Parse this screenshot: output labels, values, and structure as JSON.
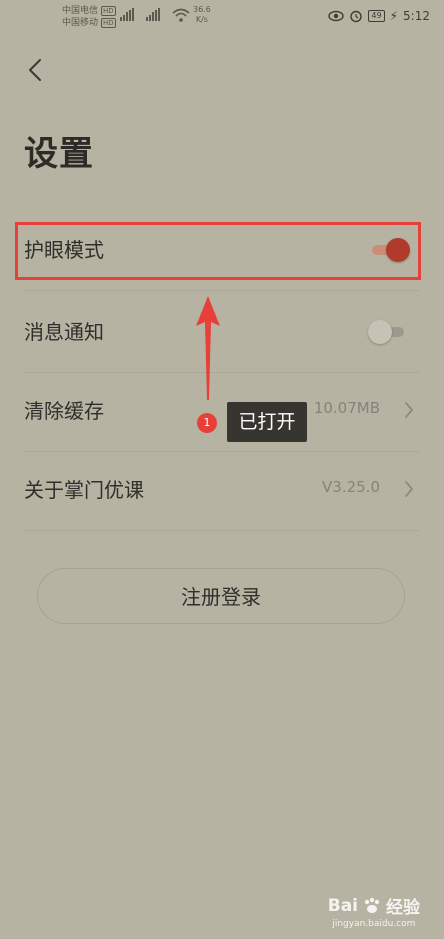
{
  "status_bar": {
    "carrier1": "中国电信",
    "carrier2": "中国移动",
    "hd_label": "HD",
    "net_speed": "36.6",
    "net_unit": "K/s",
    "battery": "49",
    "time": "5:12",
    "icons": [
      "signal-icon",
      "wifi-icon",
      "eye-icon",
      "alarm-icon",
      "battery-icon",
      "charging-icon"
    ]
  },
  "header": {
    "back_icon": "chevron-left-icon",
    "title": "设置"
  },
  "settings": {
    "items": [
      {
        "label": "护眼模式",
        "toggle": true
      },
      {
        "label": "消息通知",
        "toggle": false
      },
      {
        "label": "清除缓存",
        "value": "10.07MB"
      },
      {
        "label": "关于掌门优课",
        "value": "V3.25.0"
      }
    ]
  },
  "register_button": {
    "label": "注册登录"
  },
  "annotation": {
    "step_number": "1",
    "text": "已打开",
    "color": "#e7403a"
  },
  "watermark": {
    "brand_text": "Bai",
    "brand_suffix": "经验",
    "url": "jingyan.baidu.com"
  },
  "colors": {
    "background": "#b7b3a2",
    "toggle_on": "#b13a2c",
    "accent_red": "#e7403a"
  }
}
